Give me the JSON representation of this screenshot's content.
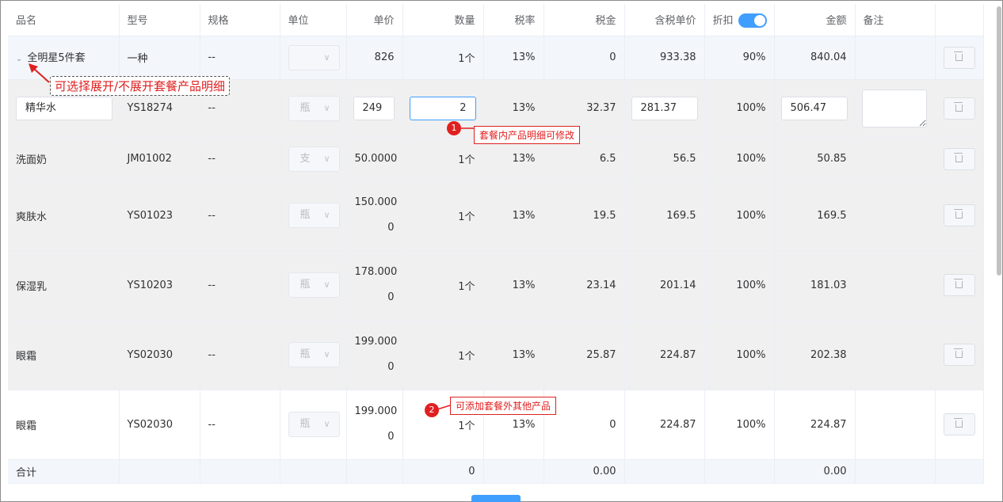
{
  "headers": {
    "name": "品名",
    "model": "型号",
    "spec": "规格",
    "unit": "单位",
    "price": "单价",
    "qty": "数量",
    "tax_rate": "税率",
    "tax": "税金",
    "price_with_tax": "含税单价",
    "discount": "折扣",
    "amount": "金额",
    "remark": "备注"
  },
  "discount_toggle_on": true,
  "group": {
    "name": "全明星5件套",
    "model": "一种",
    "spec": "--",
    "price": "826",
    "qty": "1个",
    "tax_rate": "13%",
    "tax": "0",
    "price_with_tax": "933.38",
    "discount": "90%",
    "amount": "840.04"
  },
  "row1": {
    "name": "精华水",
    "model": "YS18274",
    "spec": "--",
    "unit": "瓶",
    "price": "249",
    "qty": "2",
    "tax_rate": "13%",
    "tax": "32.37",
    "price_with_tax": "281.37",
    "discount": "100%",
    "amount": "506.47"
  },
  "row2": {
    "name": "洗面奶",
    "model": "JM01002",
    "spec": "--",
    "unit": "支",
    "price": "50.0000",
    "qty": "1个",
    "tax_rate": "13%",
    "tax": "6.5",
    "price_with_tax": "56.5",
    "discount": "100%",
    "amount": "50.85"
  },
  "row3": {
    "name": "爽肤水",
    "model": "YS01023",
    "spec": "--",
    "unit": "瓶",
    "price_a": "150.000",
    "price_b": "0",
    "qty": "1个",
    "tax_rate": "13%",
    "tax": "19.5",
    "price_with_tax": "169.5",
    "discount": "100%",
    "amount": "169.5"
  },
  "row4": {
    "name": "保湿乳",
    "model": "YS10203",
    "spec": "--",
    "unit": "瓶",
    "price_a": "178.000",
    "price_b": "0",
    "qty": "1个",
    "tax_rate": "13%",
    "tax": "23.14",
    "price_with_tax": "201.14",
    "discount": "100%",
    "amount": "181.03"
  },
  "row5": {
    "name": "眼霜",
    "model": "YS02030",
    "spec": "--",
    "unit": "瓶",
    "price_a": "199.000",
    "price_b": "0",
    "qty": "1个",
    "tax_rate": "13%",
    "tax": "25.87",
    "price_with_tax": "224.87",
    "discount": "100%",
    "amount": "202.38"
  },
  "row6": {
    "name": "眼霜",
    "model": "YS02030",
    "spec": "--",
    "unit": "瓶",
    "price_a": "199.000",
    "price_b": "0",
    "qty": "1个",
    "tax_rate": "13%",
    "tax": "0",
    "price_with_tax": "224.87",
    "discount": "100%",
    "amount": "224.87"
  },
  "total": {
    "label": "合计",
    "qty": "0",
    "tax": "0.00",
    "amount": "0.00"
  },
  "annotations": {
    "expand_note": "可选择展开/不展开套餐产品明细",
    "badge1": "1",
    "note1": "套餐内产品明细可修改",
    "badge2": "2",
    "note2": "可添加套餐外其他产品"
  },
  "colors": {
    "accent": "#409eff",
    "annotation": "#e02020"
  }
}
